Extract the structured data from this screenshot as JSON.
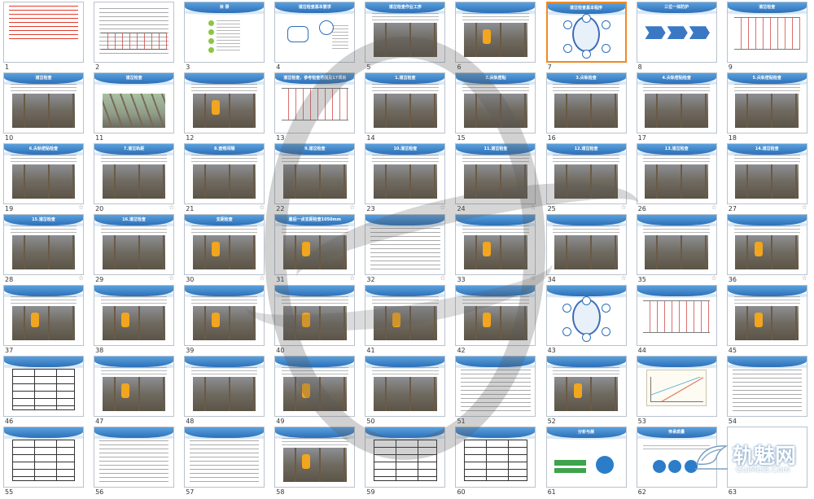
{
  "slides": [
    {
      "number": "1",
      "title": "",
      "kind": "redtext",
      "starred": false
    },
    {
      "number": "2",
      "title": "",
      "kind": "doc",
      "starred": false
    },
    {
      "number": "3",
      "title": "目 录",
      "kind": "toc",
      "starred": false
    },
    {
      "number": "4",
      "title": "道岔检查基本要求",
      "kind": "diagram-bubbles",
      "starred": false
    },
    {
      "number": "5",
      "title": "道岔检查作业工序",
      "kind": "photo",
      "starred": false
    },
    {
      "number": "6",
      "title": "",
      "kind": "photo-worker",
      "starred": false
    },
    {
      "number": "7",
      "title": "道岔检查基本程序",
      "kind": "circle",
      "starred": false,
      "selected": true
    },
    {
      "number": "8",
      "title": "三位一体防护",
      "kind": "chevrons",
      "starred": false
    },
    {
      "number": "9",
      "title": "道岔检查",
      "kind": "diagram",
      "starred": false
    },
    {
      "number": "10",
      "title": "道岔检查",
      "kind": "photo",
      "starred": false
    },
    {
      "number": "11",
      "title": "道岔检查",
      "kind": "photo-green",
      "starred": false
    },
    {
      "number": "12",
      "title": "",
      "kind": "photo-worker",
      "starred": false
    },
    {
      "number": "13",
      "title": "道岔检查，参考检查范围及17项目",
      "kind": "diagram",
      "starred": false
    },
    {
      "number": "14",
      "title": "1.道岔检查",
      "kind": "photo",
      "starred": false
    },
    {
      "number": "15",
      "title": "2.尖轨密贴",
      "kind": "photo",
      "starred": false
    },
    {
      "number": "16",
      "title": "3.尖轨检查",
      "kind": "photo",
      "starred": false
    },
    {
      "number": "17",
      "title": "4.尖轨密贴检查",
      "kind": "photo",
      "starred": false
    },
    {
      "number": "18",
      "title": "5.尖轨密贴检查",
      "kind": "photo",
      "starred": false
    },
    {
      "number": "19",
      "title": "6.尖轨密贴检查",
      "kind": "photo",
      "starred": true
    },
    {
      "number": "20",
      "title": "7.道岔轨距",
      "kind": "photo",
      "starred": true
    },
    {
      "number": "21",
      "title": "8.查照间隔",
      "kind": "photo",
      "starred": true
    },
    {
      "number": "22",
      "title": "9.道岔检查",
      "kind": "photo",
      "starred": true
    },
    {
      "number": "23",
      "title": "10.道岔检查",
      "kind": "photo",
      "starred": true
    },
    {
      "number": "24",
      "title": "11.道岔检查",
      "kind": "photo",
      "starred": true
    },
    {
      "number": "25",
      "title": "12.道岔检查",
      "kind": "photo",
      "starred": true
    },
    {
      "number": "26",
      "title": "13.道岔检查",
      "kind": "photo",
      "starred": true
    },
    {
      "number": "27",
      "title": "14.道岔检查",
      "kind": "photo",
      "starred": true
    },
    {
      "number": "28",
      "title": "15.道岔检查",
      "kind": "photo",
      "starred": true
    },
    {
      "number": "29",
      "title": "16.道岔检查",
      "kind": "photo",
      "starred": true
    },
    {
      "number": "30",
      "title": "支距检查",
      "kind": "photo-worker",
      "starred": true
    },
    {
      "number": "31",
      "title": "最后一点支距检查1050mm",
      "kind": "photo-worker",
      "starred": true
    },
    {
      "number": "32",
      "title": "",
      "kind": "textblock",
      "starred": true
    },
    {
      "number": "33",
      "title": "",
      "kind": "photo-worker",
      "starred": true
    },
    {
      "number": "34",
      "title": "",
      "kind": "photo",
      "starred": true
    },
    {
      "number": "35",
      "title": "",
      "kind": "photo",
      "starred": true
    },
    {
      "number": "36",
      "title": "",
      "kind": "photo-worker",
      "starred": true
    },
    {
      "number": "37",
      "title": "",
      "kind": "photo-worker",
      "starred": false
    },
    {
      "number": "38",
      "title": "",
      "kind": "photo-worker",
      "starred": false
    },
    {
      "number": "39",
      "title": "",
      "kind": "photo-worker",
      "starred": false
    },
    {
      "number": "40",
      "title": "",
      "kind": "photo-worker",
      "starred": false
    },
    {
      "number": "41",
      "title": "",
      "kind": "photo-worker",
      "starred": false
    },
    {
      "number": "42",
      "title": "",
      "kind": "photo-worker",
      "starred": false
    },
    {
      "number": "43",
      "title": "",
      "kind": "circle",
      "starred": false
    },
    {
      "number": "44",
      "title": "",
      "kind": "diagram",
      "starred": false
    },
    {
      "number": "45",
      "title": "",
      "kind": "photo-worker",
      "starred": false
    },
    {
      "number": "46",
      "title": "",
      "kind": "table",
      "starred": false
    },
    {
      "number": "47",
      "title": "",
      "kind": "photo-worker",
      "starred": false
    },
    {
      "number": "48",
      "title": "",
      "kind": "photo",
      "starred": false
    },
    {
      "number": "49",
      "title": "",
      "kind": "photo-worker",
      "starred": false
    },
    {
      "number": "50",
      "title": "",
      "kind": "photo",
      "starred": false
    },
    {
      "number": "51",
      "title": "",
      "kind": "textblock",
      "starred": false
    },
    {
      "number": "52",
      "title": "",
      "kind": "photo-worker",
      "starred": false
    },
    {
      "number": "53",
      "title": "",
      "kind": "chart",
      "starred": false
    },
    {
      "number": "54",
      "title": "",
      "kind": "textblock",
      "starred": false
    },
    {
      "number": "55",
      "title": "",
      "kind": "table",
      "starred": false
    },
    {
      "number": "56",
      "title": "",
      "kind": "textblock",
      "starred": false
    },
    {
      "number": "57",
      "title": "",
      "kind": "textblock",
      "starred": false
    },
    {
      "number": "58",
      "title": "",
      "kind": "photo-worker",
      "starred": false
    },
    {
      "number": "59",
      "title": "",
      "kind": "table",
      "starred": false
    },
    {
      "number": "60",
      "title": "",
      "kind": "table",
      "starred": false
    },
    {
      "number": "61",
      "title": "分析与展",
      "kind": "green",
      "starred": false
    },
    {
      "number": "62",
      "title": "传承质量",
      "kind": "bluecircles",
      "starred": false
    },
    {
      "number": "63",
      "title": "",
      "kind": "blank",
      "starred": false
    }
  ],
  "watermark": {
    "logo_text": "轨魅网",
    "logo_url": "GuiMei8.Com"
  },
  "colors": {
    "selected_border": "#f08a24",
    "slide_header": "#2c6fb8",
    "thumb_border": "#b9c2cc"
  }
}
